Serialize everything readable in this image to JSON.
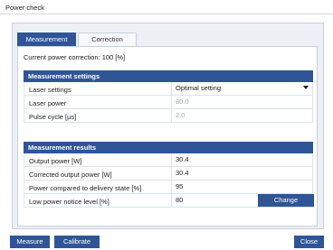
{
  "window": {
    "title": "Power check"
  },
  "tabs": [
    {
      "label": "Measurement",
      "active": true
    },
    {
      "label": "Correction",
      "active": false
    }
  ],
  "current_correction": "Current power correction: 100 [%]",
  "measurement_settings": {
    "header": "Measurement settings",
    "rows": [
      {
        "label": "Laser settings",
        "value": "Optimal setting",
        "type": "dropdown"
      },
      {
        "label": "Laser power",
        "value": "80.0",
        "type": "disabled"
      },
      {
        "label": "Pulse cycle [µs]",
        "value": "2.0",
        "type": "disabled"
      }
    ]
  },
  "measurement_results": {
    "header": "Measurement results",
    "rows": [
      {
        "label": "Output power [W]",
        "value": "30.4"
      },
      {
        "label": "Corrected output power [W]",
        "value": "30.4"
      },
      {
        "label": "Power compared to delivery state [%]",
        "value": "95"
      },
      {
        "label": "Low power notice level [%]",
        "value": "80"
      }
    ],
    "change_label": "Change"
  },
  "footer": {
    "measure_label": "Measure",
    "calibrate_label": "Calibrate",
    "close_label": "Close"
  },
  "colors": {
    "accent": "#2f5597",
    "panel_bg": "#edf0f5",
    "disabled_text": "#a0a4ab"
  }
}
